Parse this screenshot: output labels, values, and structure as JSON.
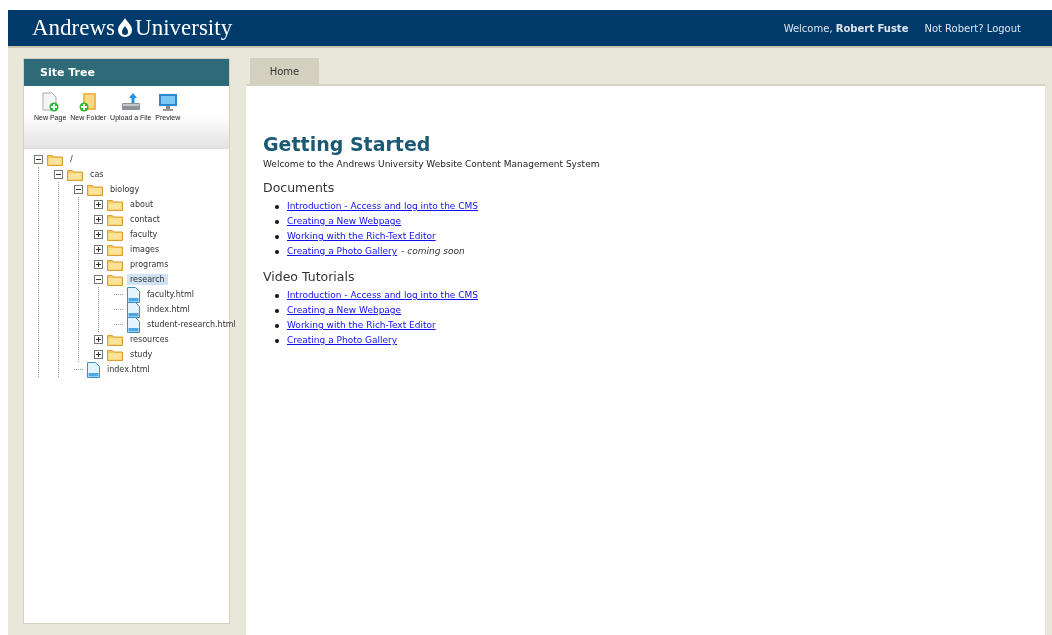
{
  "header": {
    "logo_left": "Andrews",
    "logo_right": "University",
    "welcome": "Welcome, **Robert Fuste**",
    "logout": "Not Robert? Logout"
  },
  "sidebar": {
    "title": "Site Tree",
    "toolbar": [
      {
        "kind": "new-page",
        "label": "New Page"
      },
      {
        "kind": "new-folder",
        "label": "New Folder"
      },
      {
        "kind": "upload",
        "label": "Upload a File"
      },
      {
        "kind": "preview",
        "label": "Preview"
      }
    ],
    "tree": [
      {
        "kind": "folder",
        "label": "/",
        "expanded": true,
        "selected": false,
        "children": [
          {
            "kind": "folder",
            "label": "cas",
            "expanded": true,
            "selected": false,
            "children": [
              {
                "kind": "folder",
                "label": "biology",
                "expanded": true,
                "selected": false,
                "children": [
                  {
                    "kind": "folder",
                    "label": "about",
                    "expanded": false,
                    "selected": false
                  },
                  {
                    "kind": "folder",
                    "label": "contact",
                    "expanded": false,
                    "selected": false
                  },
                  {
                    "kind": "folder",
                    "label": "faculty",
                    "expanded": false,
                    "selected": false
                  },
                  {
                    "kind": "folder",
                    "label": "images",
                    "expanded": false,
                    "selected": false
                  },
                  {
                    "kind": "folder",
                    "label": "programs",
                    "expanded": false,
                    "selected": false
                  },
                  {
                    "kind": "folder",
                    "label": "research",
                    "expanded": true,
                    "selected": true,
                    "children": [
                      {
                        "kind": "file",
                        "label": "faculty.html",
                        "selected": false
                      },
                      {
                        "kind": "file",
                        "label": "index.html",
                        "selected": false
                      },
                      {
                        "kind": "file",
                        "label": "student-research.html",
                        "selected": false
                      }
                    ]
                  },
                  {
                    "kind": "folder",
                    "label": "resources",
                    "expanded": false,
                    "selected": false
                  },
                  {
                    "kind": "folder",
                    "label": "study",
                    "expanded": false,
                    "selected": false
                  }
                ]
              },
              {
                "kind": "file",
                "label": "index.html",
                "selected": false
              }
            ]
          }
        ]
      }
    ]
  },
  "tabs": [
    {
      "label": "Home",
      "selected": true
    }
  ],
  "content": {
    "title": "Getting Started",
    "intro": "Welcome to the Andrews University Website Content Management System",
    "sections": [
      {
        "heading": "Documents",
        "links": [
          {
            "text": "Introduction - Access and log into the CMS"
          },
          {
            "text": "Creating a New Webpage"
          },
          {
            "text": "Working with the Rich-Text Editor"
          },
          {
            "text": "Creating a Photo Gallery",
            "note": "- *coming soon*"
          }
        ]
      },
      {
        "heading": "Video Tutorials",
        "links": [
          {
            "text": "Introduction - Access and log into the CMS"
          },
          {
            "text": "Creating a New Webpage"
          },
          {
            "text": "Working with the Rich-Text Editor"
          },
          {
            "text": "Creating a Photo Gallery"
          }
        ]
      }
    ]
  }
}
